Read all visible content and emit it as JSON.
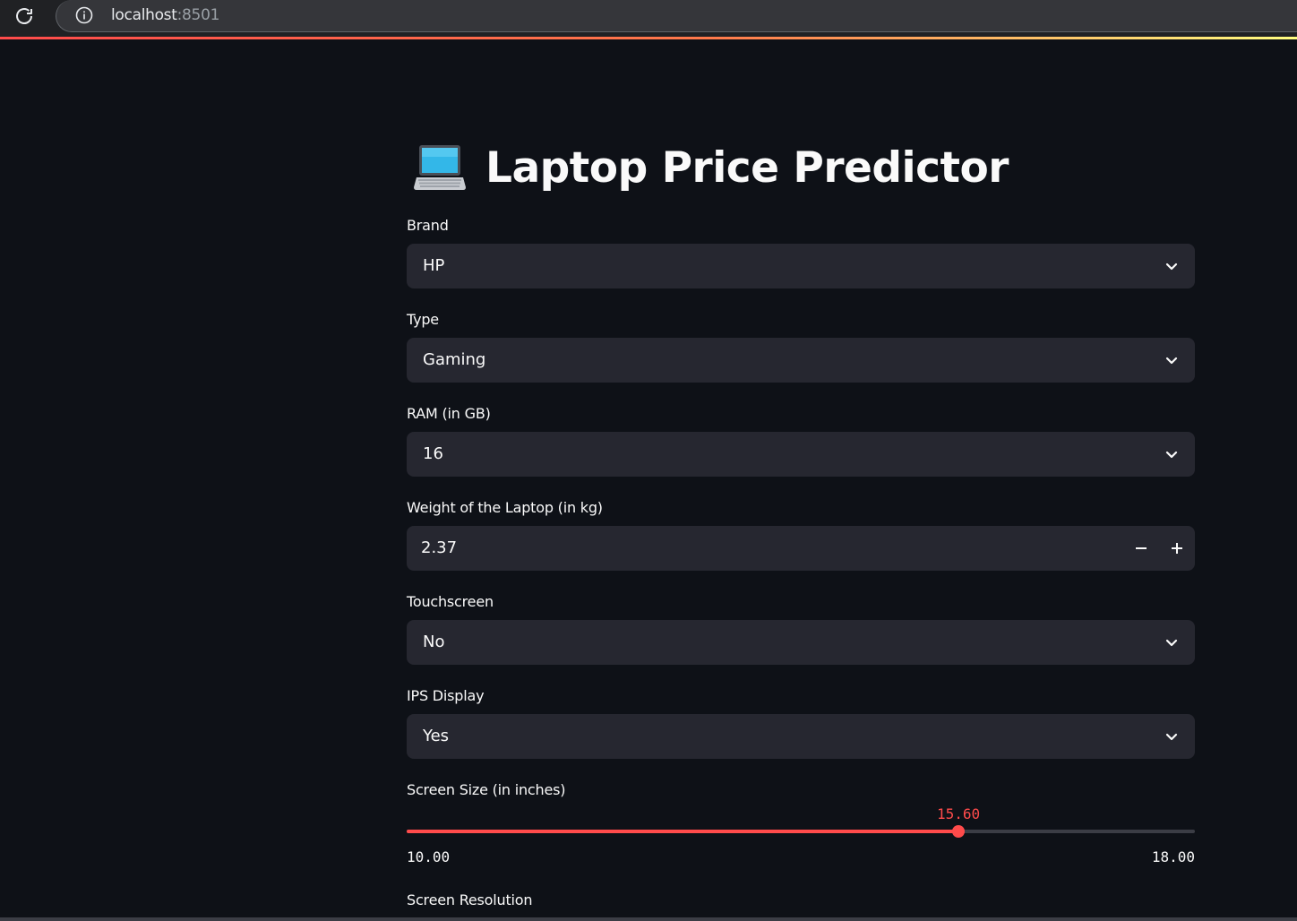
{
  "browser": {
    "url_host": "localhost",
    "url_port": ":8501"
  },
  "page": {
    "title": "Laptop Price Predictor"
  },
  "colors": {
    "accent": "#ff4b4b",
    "background": "#0e1117",
    "input_background": "#262730"
  },
  "fields": {
    "brand": {
      "label": "Brand",
      "value": "HP"
    },
    "type": {
      "label": "Type",
      "value": "Gaming"
    },
    "ram": {
      "label": "RAM (in GB)",
      "value": "16"
    },
    "weight": {
      "label": "Weight of the Laptop (in kg)",
      "value": "2.37"
    },
    "touchscreen": {
      "label": "Touchscreen",
      "value": "No"
    },
    "ips": {
      "label": "IPS Display",
      "value": "Yes"
    },
    "screen_size": {
      "label": "Screen Size (in inches)",
      "value_text": "15.60",
      "min_text": "10.00",
      "max_text": "18.00",
      "value": 15.6,
      "min": 10,
      "max": 18
    },
    "resolution": {
      "label": "Screen Resolution"
    }
  },
  "icons": {
    "reload": "reload-icon",
    "info": "info-icon",
    "laptop": "laptop-emoji-icon",
    "chevron": "chevron-down-icon",
    "minus": "minus-icon",
    "plus": "plus-icon"
  }
}
